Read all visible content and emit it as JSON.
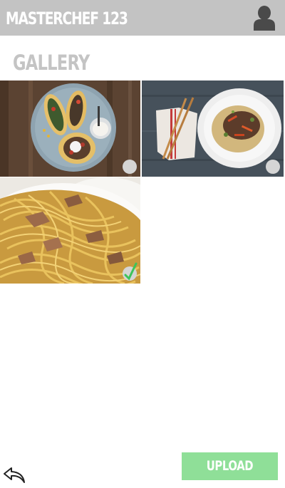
{
  "header": {
    "title": "MASTERCHEF 123",
    "profile_icon": "user-silhouette-icon"
  },
  "gallery": {
    "title": "GALLERY",
    "items": [
      {
        "subject": "tacos",
        "selected": false
      },
      {
        "subject": "stir-fry-with-chopsticks",
        "selected": false
      },
      {
        "subject": "spaghetti",
        "selected": true
      }
    ]
  },
  "footer": {
    "back_icon": "reply-arrow-icon",
    "upload_label": "UPLOAD"
  },
  "colors": {
    "header_bg": "#c3c3c3",
    "title_gray": "#c4c4c4",
    "upload_green": "#8fdf98",
    "check_green": "#3cc45a",
    "indicator_gray": "#d5d5d5"
  }
}
